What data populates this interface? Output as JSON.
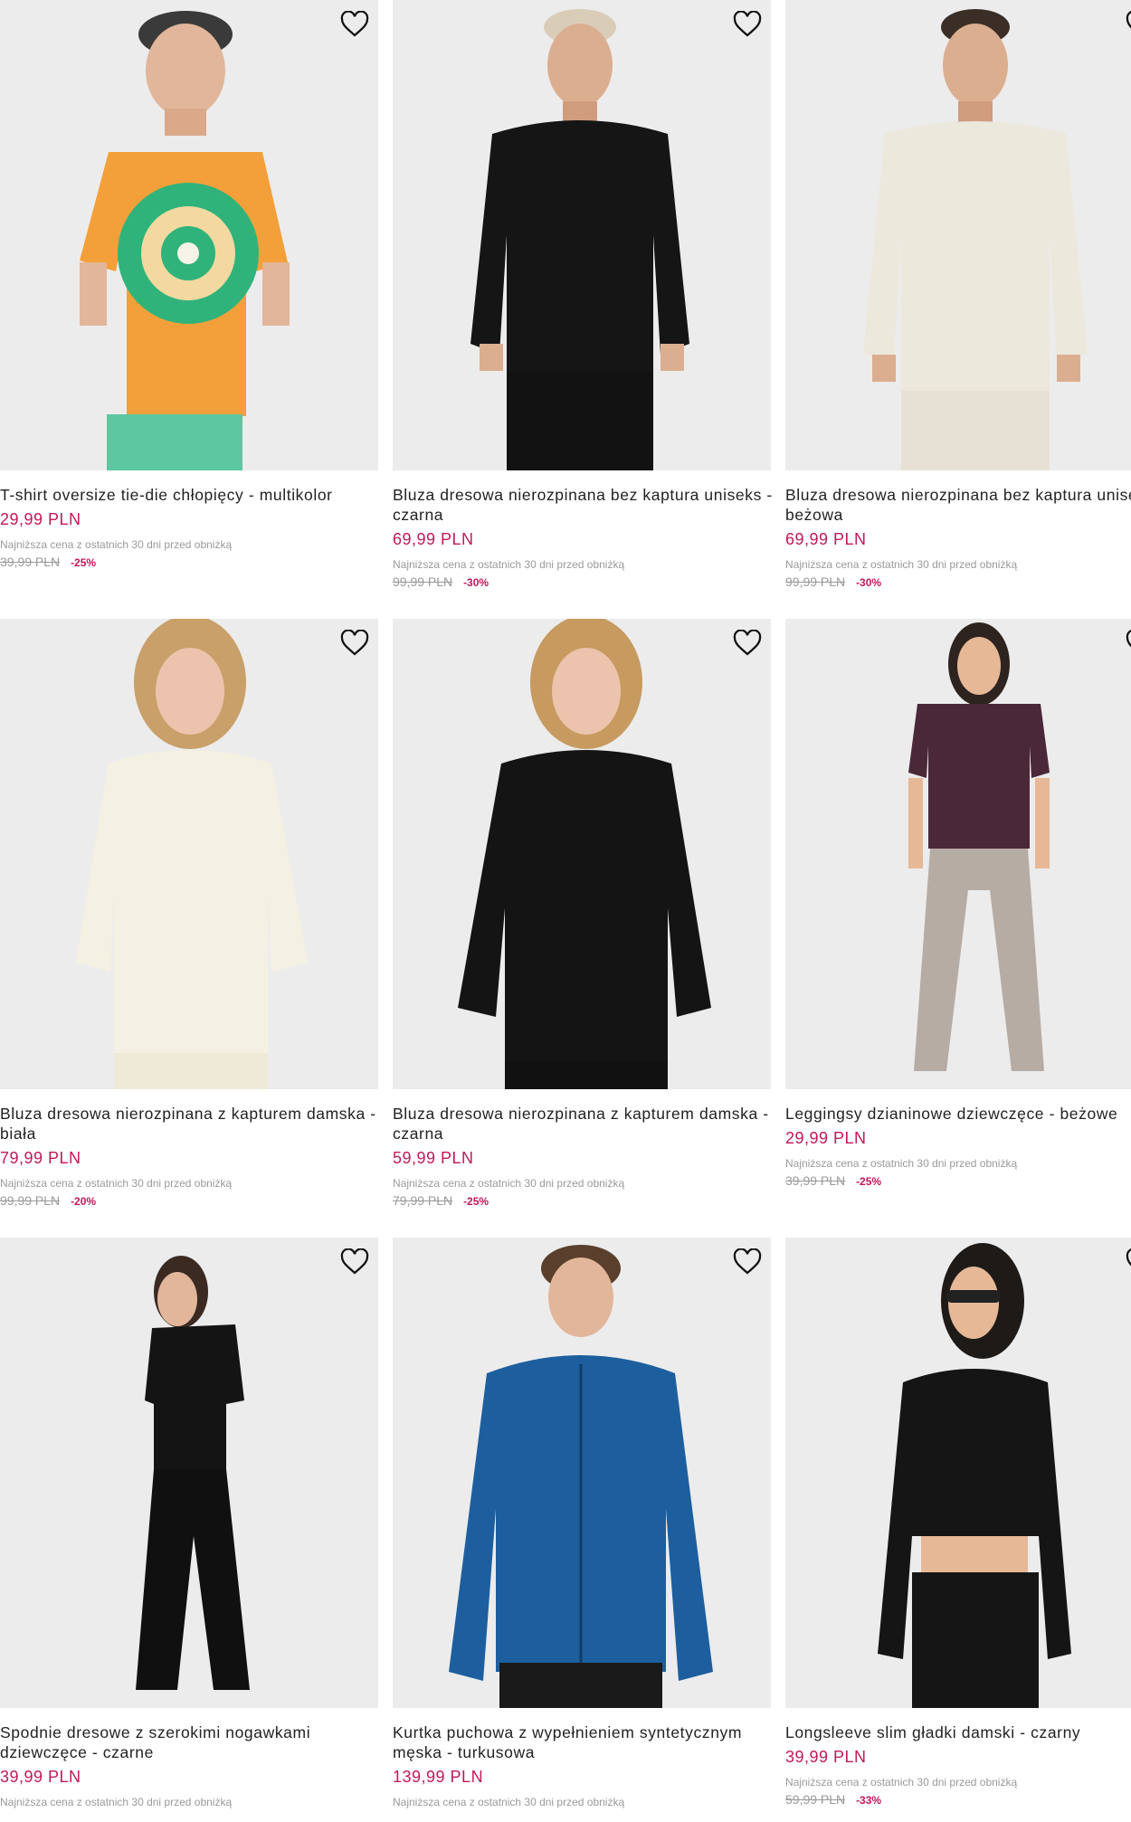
{
  "colors": {
    "price": "#c2185b",
    "muted": "#9a9a9a",
    "card_bg": "#ececec"
  },
  "products": [
    {
      "title": "T-shirt oversize tie-die chłopięcy - multikolor",
      "price": "29,99 PLN",
      "lowest_label": "Najniższa cena z ostatnich 30 dni przed obniżką",
      "old_price": "39,99 PLN",
      "discount": "-25%",
      "image": "boy-tie-dye-tshirt"
    },
    {
      "title": "Bluza dresowa nierozpinana bez kaptura uniseks - czarna",
      "price": "69,99 PLN",
      "lowest_label": "Najniższa cena z ostatnich 30 dni przed obniżką",
      "old_price": "99,99 PLN",
      "discount": "-30%",
      "image": "man-black-sweatshirt"
    },
    {
      "title": "Bluza dresowa nierozpinana bez kaptura uniseks - beżowa",
      "price": "69,99 PLN",
      "lowest_label": "Najniższa cena z ostatnich 30 dni przed obniżką",
      "old_price": "99,99 PLN",
      "discount": "-30%",
      "image": "man-beige-sweatshirt"
    },
    {
      "title": "Bluza dresowa nierozpinana z kapturem damska - biała",
      "price": "79,99 PLN",
      "lowest_label": "Najniższa cena z ostatnich 30 dni przed obniżką",
      "old_price": "99,99 PLN",
      "discount": "-20%",
      "image": "woman-white-hoodie"
    },
    {
      "title": "Bluza dresowa nierozpinana z kapturem damska - czarna",
      "price": "59,99 PLN",
      "lowest_label": "Najniższa cena z ostatnich 30 dni przed obniżką",
      "old_price": "79,99 PLN",
      "discount": "-25%",
      "image": "woman-black-hoodie"
    },
    {
      "title": "Leggingsy dzianinowe dziewczęce - beżowe",
      "price": "29,99 PLN",
      "lowest_label": "Najniższa cena z ostatnich 30 dni przed obniżką",
      "old_price": "39,99 PLN",
      "discount": "-25%",
      "image": "girl-purple-tshirt-leggings"
    },
    {
      "title": "Spodnie dresowe z szerokimi nogawkami dziewczęce - czarne",
      "price": "39,99 PLN",
      "lowest_label": "Najniższa cena z ostatnich 30 dni przed obniżką",
      "old_price": "",
      "discount": "",
      "image": "girl-black-tracksuit"
    },
    {
      "title": "Kurtka puchowa z wypełnieniem syntetycznym męska - turkusowa",
      "price": "139,99 PLN",
      "lowest_label": "Najniższa cena z ostatnich 30 dni przed obniżką",
      "old_price": "",
      "discount": "",
      "image": "boy-blue-puffer-jacket"
    },
    {
      "title": "Longsleeve slim gładki damski - czarny",
      "price": "39,99 PLN",
      "lowest_label": "Najniższa cena z ostatnich 30 dni przed obniżką",
      "old_price": "59,99 PLN",
      "discount": "-33%",
      "image": "woman-black-longsleeve"
    }
  ]
}
